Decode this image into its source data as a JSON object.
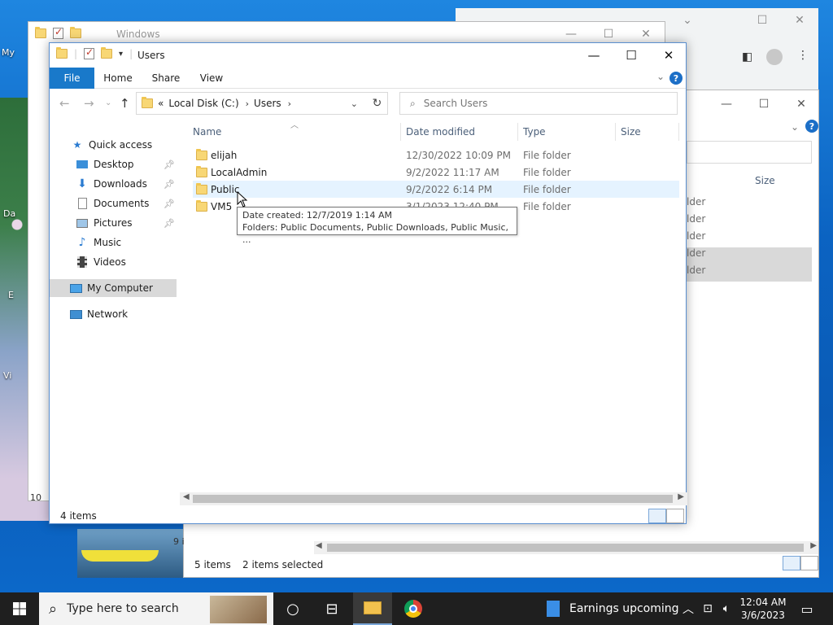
{
  "desktop": {
    "labels": [
      "My",
      "Da",
      "E",
      "Vi"
    ]
  },
  "bg_window_top": {
    "title": "Windows"
  },
  "lower_window": {
    "col_size": "Size",
    "rows_partial": [
      "lder",
      "lder",
      "lder",
      "lder",
      "lder"
    ],
    "status_count": "5 items",
    "status_selected": "2 items selected",
    "left_fragment_1": "10",
    "left_fragment_2": "9 i"
  },
  "window": {
    "title": "Users",
    "tabs": {
      "file": "File",
      "home": "Home",
      "share": "Share",
      "view": "View"
    },
    "help": "?",
    "address": {
      "overflow": "«",
      "segments": [
        "Local Disk (C:)",
        "Users"
      ]
    },
    "search_placeholder": "Search Users",
    "columns": {
      "name": "Name",
      "date": "Date modified",
      "type": "Type",
      "size": "Size"
    },
    "nav": {
      "quick_access": "Quick access",
      "desktop": "Desktop",
      "downloads": "Downloads",
      "documents": "Documents",
      "pictures": "Pictures",
      "music": "Music",
      "videos": "Videos",
      "my_computer": "My Computer",
      "network": "Network"
    },
    "rows": [
      {
        "name": "elijah",
        "date": "12/30/2022 10:09 PM",
        "type": "File folder"
      },
      {
        "name": "LocalAdmin",
        "date": "9/2/2022 11:17 AM",
        "type": "File folder"
      },
      {
        "name": "Public",
        "date": "9/2/2022 6:14 PM",
        "type": "File folder"
      },
      {
        "name": "VM5",
        "date": "3/1/2023 12:40 PM",
        "type": "File folder"
      }
    ],
    "tooltip": {
      "line1": "Date created: 12/7/2019 1:14 AM",
      "line2": "Folders: Public Documents, Public Downloads, Public Music, ..."
    },
    "status": "4 items"
  },
  "taskbar": {
    "search_placeholder": "Type here to search",
    "news": "Earnings upcoming",
    "time": "12:04 AM",
    "date": "3/6/2023"
  },
  "colors": {
    "accent": "#1979ca",
    "taskbar": "#1f1f1f",
    "hover_row": "#e5f3ff"
  }
}
